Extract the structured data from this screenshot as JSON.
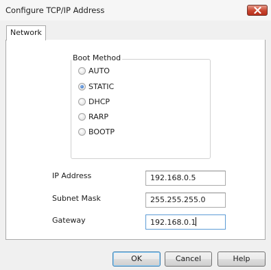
{
  "window": {
    "title": "Configure TCP/IP Address",
    "close_icon": "close-x-icon"
  },
  "tabs": [
    {
      "label": "Network",
      "selected": true
    }
  ],
  "boot_method": {
    "legend": "Boot Method",
    "selected": "STATIC",
    "options": [
      {
        "label": "AUTO"
      },
      {
        "label": "STATIC"
      },
      {
        "label": "DHCP"
      },
      {
        "label": "RARP"
      },
      {
        "label": "BOOTP"
      }
    ]
  },
  "fields": {
    "ip_address": {
      "label": "IP Address",
      "value": "192.168.0.5"
    },
    "subnet_mask": {
      "label": "Subnet Mask",
      "value": "255.255.255.0"
    },
    "gateway": {
      "label": "Gateway",
      "value": "192.168.0.1"
    }
  },
  "buttons": {
    "ok": "OK",
    "cancel": "Cancel",
    "help": "Help"
  },
  "colors": {
    "close_button": "#c8452f",
    "selected_radio": "#1f5fbf",
    "focus_border": "#5b9bd5"
  }
}
